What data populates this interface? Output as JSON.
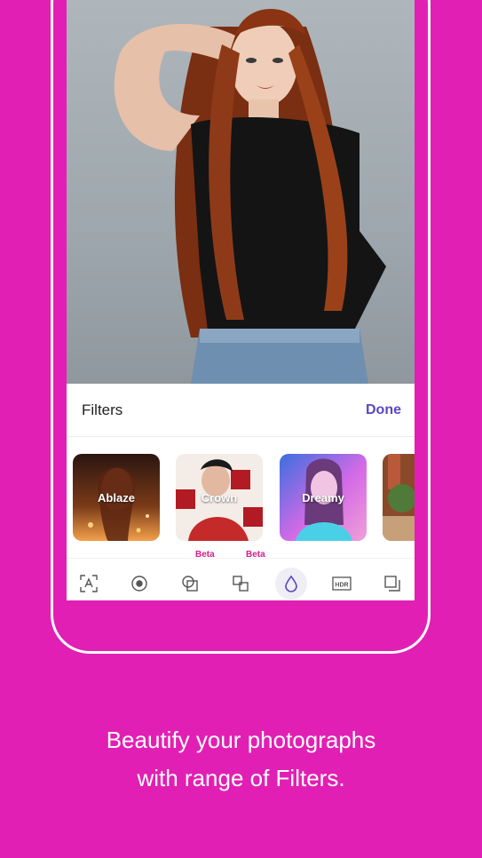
{
  "filters_panel": {
    "title": "Filters",
    "done_label": "Done"
  },
  "filters": [
    {
      "label": "Ablaze",
      "colors": [
        "#2b1510",
        "#c06a2a",
        "#f2a04a"
      ]
    },
    {
      "label": "Crown",
      "colors": [
        "#f4ece6",
        "#b21b24",
        "#e2c9b8"
      ]
    },
    {
      "label": "Dreamy",
      "colors": [
        "#3a6fe0",
        "#d46ae6",
        "#f0a0d8"
      ]
    },
    {
      "label": "",
      "colors": [
        "#8a4a2a",
        "#4f7a3a",
        "#c7a07a"
      ]
    }
  ],
  "toolbar": {
    "items": [
      {
        "icon": "portrait-scan-icon",
        "beta": ""
      },
      {
        "icon": "focus-circle-icon",
        "beta": ""
      },
      {
        "icon": "overlay-squares-icon",
        "beta": "Beta"
      },
      {
        "icon": "clone-squares-icon",
        "beta": "Beta"
      },
      {
        "icon": "drop-icon",
        "beta": ""
      },
      {
        "icon": "hdr-icon",
        "beta": "",
        "text": "HDR"
      },
      {
        "icon": "layers-icon",
        "beta": ""
      }
    ],
    "active_icon": "drop-icon"
  },
  "caption": {
    "line1": "Beautify your photographs",
    "line2": "with range of Filters."
  },
  "colors": {
    "background": "#e21fb4",
    "accent": "#5a48c4",
    "beta": "#d81b8a"
  }
}
